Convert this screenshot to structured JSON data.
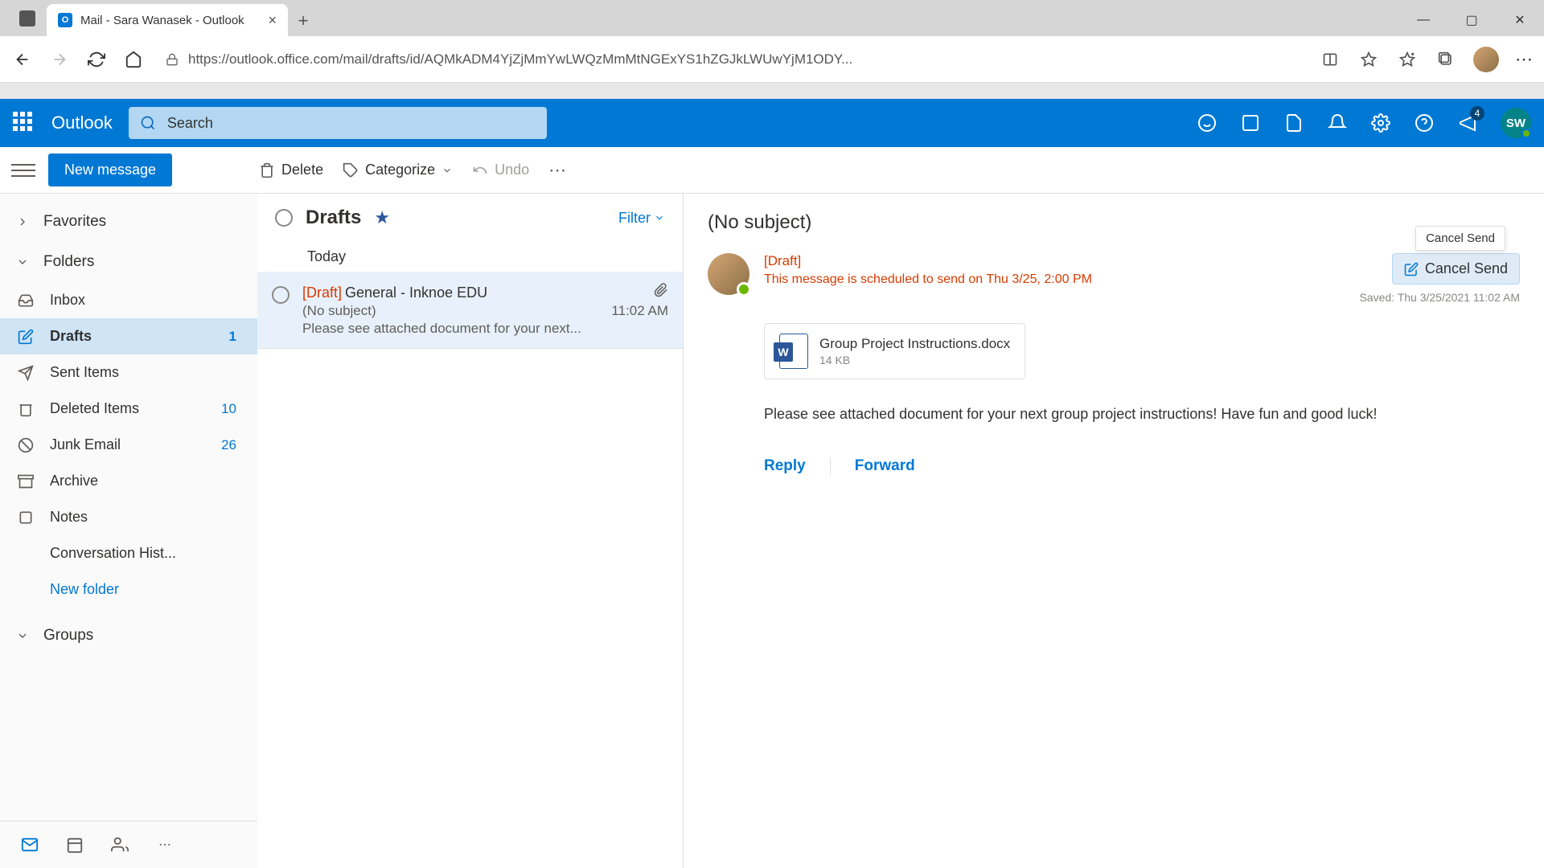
{
  "browser": {
    "tab_title": "Mail - Sara Wanasek - Outlook",
    "url": "https://outlook.office.com/mail/drafts/id/AQMkADM4YjZjMmYwLWQzMmMtNGExYS1hZGJkLWUwYjM1ODY..."
  },
  "header": {
    "app_name": "Outlook",
    "search_placeholder": "Search",
    "notification_badge": "4",
    "profile_initials": "SW"
  },
  "toolbar": {
    "new_message": "New message",
    "delete": "Delete",
    "categorize": "Categorize",
    "undo": "Undo"
  },
  "sidebar": {
    "favorites_label": "Favorites",
    "folders_label": "Folders",
    "groups_label": "Groups",
    "folders": [
      {
        "name": "Inbox",
        "count": ""
      },
      {
        "name": "Drafts",
        "count": "1"
      },
      {
        "name": "Sent Items",
        "count": ""
      },
      {
        "name": "Deleted Items",
        "count": "10"
      },
      {
        "name": "Junk Email",
        "count": "26"
      },
      {
        "name": "Archive",
        "count": ""
      },
      {
        "name": "Notes",
        "count": ""
      },
      {
        "name": "Conversation Hist...",
        "count": ""
      }
    ],
    "new_folder": "New folder"
  },
  "list": {
    "folder_name": "Drafts",
    "filter": "Filter",
    "group_today": "Today",
    "item": {
      "draft_tag": "[Draft]",
      "sender": "General - Inknoe EDU",
      "subject": "(No subject)",
      "time": "11:02 AM",
      "preview": "Please see attached document for your next..."
    }
  },
  "reading": {
    "subject": "(No subject)",
    "draft_label": "[Draft]",
    "schedule": "This message is scheduled to send on Thu 3/25, 2:00 PM",
    "cancel_tooltip": "Cancel Send",
    "cancel_button": "Cancel Send",
    "saved": "Saved: Thu 3/25/2021 11:02 AM",
    "attachment_name": "Group Project Instructions.docx",
    "attachment_size": "14 KB",
    "body": "Please see attached document for your next group project instructions! Have fun and good luck!",
    "reply": "Reply",
    "forward": "Forward"
  }
}
